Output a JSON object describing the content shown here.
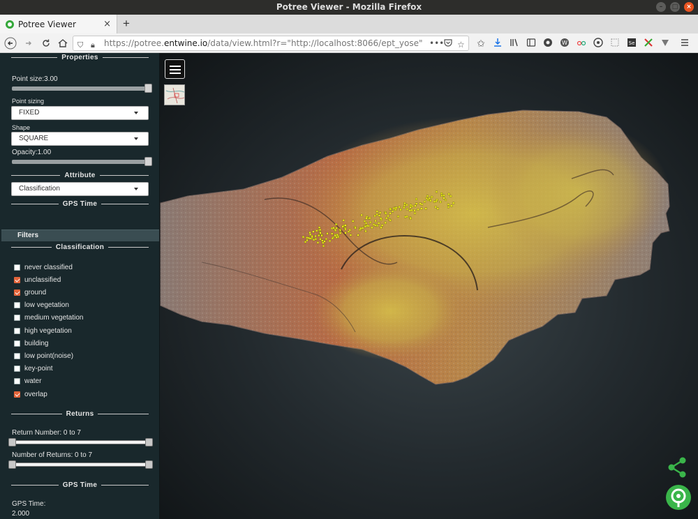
{
  "window": {
    "title": "Potree Viewer - Mozilla Firefox"
  },
  "tab": {
    "title": "Potree Viewer",
    "close": "×",
    "new_tab": "+"
  },
  "nav": {
    "url_scheme": "https://potree.",
    "url_domain": "entwine.io",
    "url_path": "/data/view.html?r=\"http://localhost:8066/ept_yose\"",
    "page_actions": "•••"
  },
  "sidebar": {
    "properties": {
      "header": "Properties",
      "point_size_label": "Point size:3.00",
      "point_size_value": 1.0,
      "point_sizing_label": "Point sizing",
      "point_sizing_value": "FIXED",
      "shape_label": "Shape",
      "shape_value": "SQUARE",
      "opacity_label": "Opacity:1.00",
      "opacity_value": 1.0
    },
    "attribute": {
      "header": "Attribute",
      "value": "Classification",
      "gps_header": "GPS Time"
    },
    "filters": {
      "label": "Filters"
    },
    "classification": {
      "header": "Classification",
      "items": [
        {
          "label": "never classified",
          "checked": false
        },
        {
          "label": "unclassified",
          "checked": true
        },
        {
          "label": "ground",
          "checked": true
        },
        {
          "label": "low vegetation",
          "checked": false
        },
        {
          "label": "medium vegetation",
          "checked": false
        },
        {
          "label": "high vegetation",
          "checked": false
        },
        {
          "label": "building",
          "checked": false
        },
        {
          "label": "low point(noise)",
          "checked": false
        },
        {
          "label": "key-point",
          "checked": false
        },
        {
          "label": "water",
          "checked": false
        },
        {
          "label": "overlap",
          "checked": true
        }
      ]
    },
    "returns": {
      "header": "Returns",
      "return_number_label": "Return Number: 0 to 7",
      "number_of_returns_label": "Number of Returns: 0 to 7"
    },
    "gps": {
      "header": "GPS Time",
      "label": "GPS Time:",
      "value": "2.000"
    }
  },
  "colors": {
    "accent": "#e2643a",
    "panel_bg": "#19282c",
    "brand_green": "#3ab54a"
  }
}
